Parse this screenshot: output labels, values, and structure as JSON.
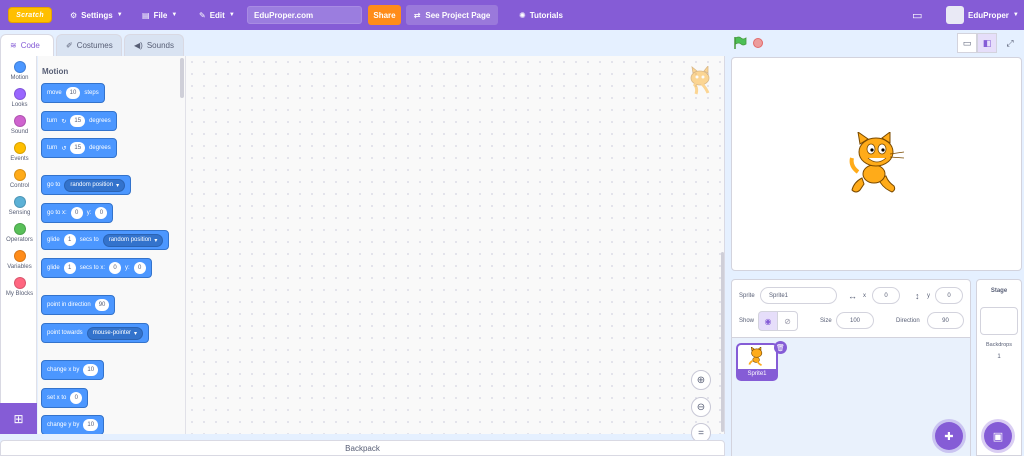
{
  "menu": {
    "logo": "Scratch",
    "settings": "Settings",
    "file": "File",
    "edit": "Edit",
    "project_title": "EduProper.com",
    "share": "Share",
    "see_project": "See Project Page",
    "tutorials": "Tutorials",
    "username": "EduProper"
  },
  "tabs": {
    "code": "Code",
    "costumes": "Costumes",
    "sounds": "Sounds"
  },
  "categories": [
    {
      "label": "Motion",
      "color": "#4c97ff"
    },
    {
      "label": "Looks",
      "color": "#9966ff"
    },
    {
      "label": "Sound",
      "color": "#cf63cf"
    },
    {
      "label": "Events",
      "color": "#ffbf00"
    },
    {
      "label": "Control",
      "color": "#ffab19"
    },
    {
      "label": "Sensing",
      "color": "#5cb1d6"
    },
    {
      "label": "Operators",
      "color": "#59c059"
    },
    {
      "label": "Variables",
      "color": "#ff8c1a"
    },
    {
      "label": "My Blocks",
      "color": "#ff6680"
    }
  ],
  "palette": {
    "title": "Motion",
    "move": {
      "a": "move",
      "v": "10",
      "b": "steps"
    },
    "turn_right": {
      "a": "turn",
      "v": "15",
      "b": "degrees"
    },
    "turn_left": {
      "a": "turn",
      "v": "15",
      "b": "degrees"
    },
    "goto": {
      "a": "go to",
      "d": "random position"
    },
    "goto_xy": {
      "a": "go to x:",
      "x": "0",
      "b": "y:",
      "y": "0"
    },
    "glide_to": {
      "a": "glide",
      "v": "1",
      "b": "secs to",
      "d": "random position"
    },
    "glide_xy": {
      "a": "glide",
      "v": "1",
      "b": "secs to x:",
      "x": "0",
      "c": "y:",
      "y": "0"
    },
    "point_dir": {
      "a": "point in direction",
      "v": "90"
    },
    "point_towards": {
      "a": "point towards",
      "d": "mouse-pointer"
    },
    "change_x": {
      "a": "change x by",
      "v": "10"
    },
    "set_x": {
      "a": "set x to",
      "v": "0"
    },
    "change_y": {
      "a": "change y by",
      "v": "10"
    }
  },
  "backpack": "Backpack",
  "sprite_info": {
    "sprite_label": "Sprite",
    "sprite_name": "Sprite1",
    "x_label": "x",
    "x_value": "0",
    "y_label": "y",
    "y_value": "0",
    "show_label": "Show",
    "size_label": "Size",
    "size_value": "100",
    "direction_label": "Direction",
    "direction_value": "90"
  },
  "sprites": [
    {
      "name": "Sprite1"
    }
  ],
  "stage_panel": {
    "title": "Stage",
    "backdrops_label": "Backdrops",
    "backdrops_count": "1"
  }
}
